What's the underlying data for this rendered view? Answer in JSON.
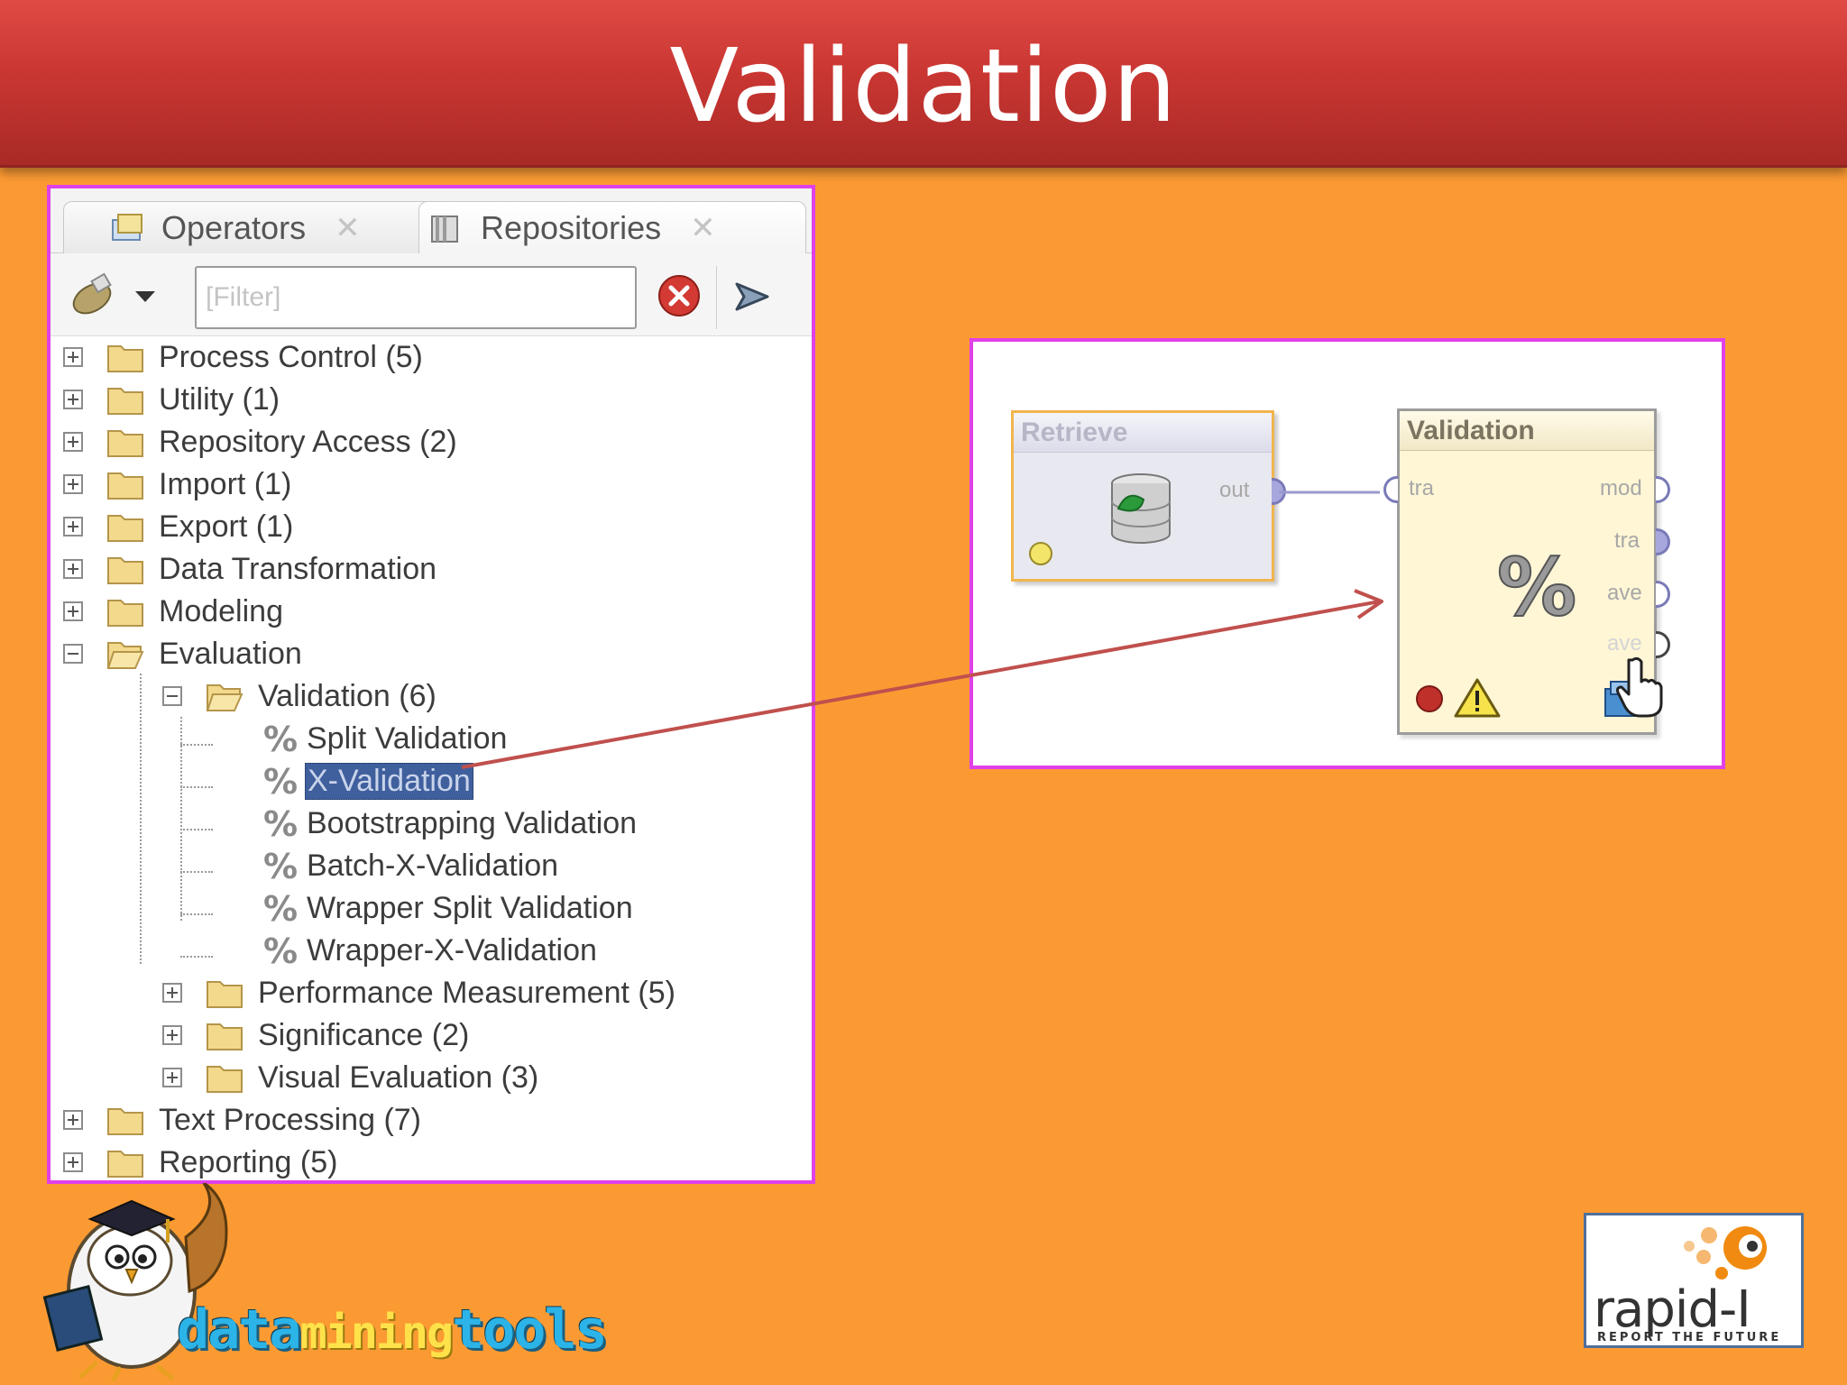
{
  "slide": {
    "title": "Validation"
  },
  "operators_panel": {
    "tabs": [
      {
        "label": "Operators"
      },
      {
        "label": "Repositories"
      }
    ],
    "filter": {
      "placeholder": "[Filter]"
    },
    "tree": [
      {
        "label": "Process Control (5)"
      },
      {
        "label": "Utility (1)"
      },
      {
        "label": "Repository Access (2)"
      },
      {
        "label": "Import (1)"
      },
      {
        "label": "Export (1)"
      },
      {
        "label": "Data Transformation"
      },
      {
        "label": "Modeling"
      },
      {
        "label": "Evaluation"
      },
      {
        "label": "Validation (6)"
      },
      {
        "label": "Split Validation"
      },
      {
        "label": "X-Validation"
      },
      {
        "label": "Bootstrapping Validation"
      },
      {
        "label": "Batch-X-Validation"
      },
      {
        "label": "Wrapper Split Validation"
      },
      {
        "label": "Wrapper-X-Validation"
      },
      {
        "label": "Performance Measurement (5)"
      },
      {
        "label": "Significance (2)"
      },
      {
        "label": "Visual Evaluation (3)"
      },
      {
        "label": "Text Processing (7)"
      },
      {
        "label": "Reporting (5)"
      }
    ],
    "selected_item": "X-Validation"
  },
  "process_panel": {
    "retrieve": {
      "title": "Retrieve",
      "ports": {
        "out": "out"
      }
    },
    "validation": {
      "title": "Validation",
      "ports": {
        "in": "tra",
        "out1": "mod",
        "out2": "tra",
        "out3": "ave",
        "out4": "ave"
      }
    }
  },
  "logos": {
    "datamining_prefix": "data",
    "datamining_mid": "mining",
    "datamining_suffix": "tools",
    "rapid_word": "rapid-I",
    "rapid_tagline": "REPORT THE FUTURE"
  },
  "colors": {
    "background": "#fb9a33",
    "title_bar": "#c93632",
    "panel_border": "#e040e8",
    "arrow": "#c0504d",
    "selection": "#3f5f9d"
  }
}
